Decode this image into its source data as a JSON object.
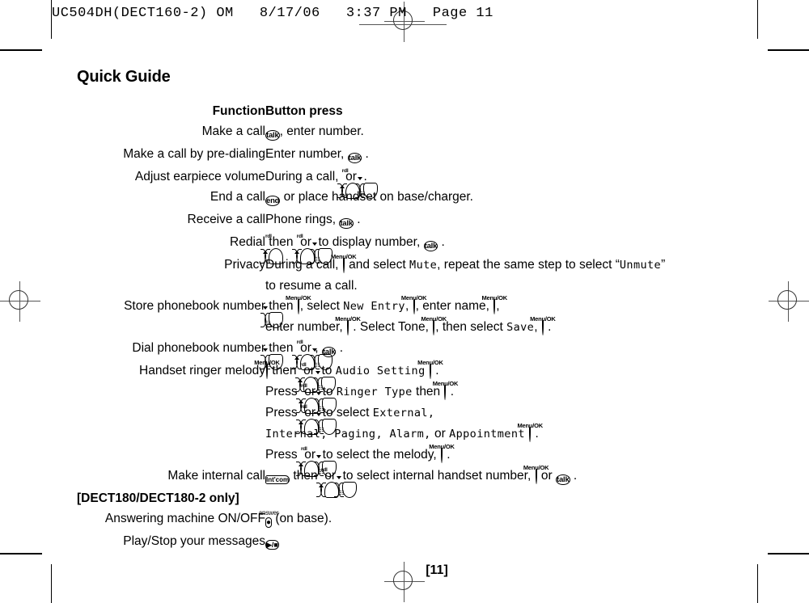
{
  "header_stamp": "UC504DH(DECT160-2) OM   8/17/06   3:37 PM   Page 11",
  "page_title": "Quick Guide",
  "columns": {
    "function": "Function",
    "button_press": "Button press"
  },
  "keys": {
    "talk": "talk",
    "end": "end",
    "intcom": "Int'com",
    "menu_ok": "Menu/OK",
    "nav_up": "rdl",
    "nav_down": "☷",
    "answer_cap": "answer",
    "answer_glyph": "●",
    "play_stop": "▶/■"
  },
  "rows": [
    {
      "function": "Make a call",
      "segments": [
        {
          "t": "key",
          "k": "talk"
        },
        {
          "t": "txt",
          "v": ", enter number."
        }
      ]
    },
    {
      "function": "Make a call by pre-dialing",
      "segments": [
        {
          "t": "txt",
          "v": "Enter number, "
        },
        {
          "t": "key",
          "k": "talk"
        },
        {
          "t": "txt",
          "v": " ."
        }
      ]
    },
    {
      "function": "Adjust earpiece volume",
      "segments": [
        {
          "t": "txt",
          "v": "During a call, "
        },
        {
          "t": "key",
          "k": "nav_up"
        },
        {
          "t": "txt",
          "v": " or "
        },
        {
          "t": "key",
          "k": "nav_down"
        },
        {
          "t": "txt",
          "v": " ."
        }
      ]
    },
    {
      "function": "End a call",
      "segments": [
        {
          "t": "key",
          "k": "end"
        },
        {
          "t": "txt",
          "v": " or place handset on base/charger."
        }
      ]
    },
    {
      "function": "Receive a call",
      "segments": [
        {
          "t": "txt",
          "v": "Phone rings, "
        },
        {
          "t": "key",
          "k": "talk"
        },
        {
          "t": "txt",
          "v": " ."
        }
      ]
    },
    {
      "function": "Redial",
      "segments": [
        {
          "t": "key",
          "k": "nav_up"
        },
        {
          "t": "txt",
          "v": " then "
        },
        {
          "t": "key",
          "k": "nav_up"
        },
        {
          "t": "txt",
          "v": " or "
        },
        {
          "t": "key",
          "k": "nav_down"
        },
        {
          "t": "txt",
          "v": " to display number, "
        },
        {
          "t": "key",
          "k": "talk"
        },
        {
          "t": "txt",
          "v": " ."
        }
      ]
    },
    {
      "function": "Privacy",
      "segments": [
        {
          "t": "txt",
          "v": "During a call, "
        },
        {
          "t": "key",
          "k": "menu_ok"
        },
        {
          "t": "txt",
          "v": " and select "
        },
        {
          "t": "lcd",
          "v": "Mute"
        },
        {
          "t": "txt",
          "v": ", repeat the same step to select “"
        },
        {
          "t": "lcd",
          "v": "Unmute"
        },
        {
          "t": "txt",
          "v": "”"
        },
        {
          "t": "br"
        },
        {
          "t": "txt",
          "v": "to resume a call."
        }
      ]
    },
    {
      "function": "Store phonebook number",
      "segments": [
        {
          "t": "key",
          "k": "nav_down"
        },
        {
          "t": "txt",
          "v": " then "
        },
        {
          "t": "key",
          "k": "menu_ok"
        },
        {
          "t": "txt",
          "v": ", select "
        },
        {
          "t": "lcd",
          "v": "New Entry"
        },
        {
          "t": "txt",
          "v": ", "
        },
        {
          "t": "key",
          "k": "menu_ok"
        },
        {
          "t": "txt",
          "v": ", enter name, "
        },
        {
          "t": "key",
          "k": "menu_ok"
        },
        {
          "t": "txt",
          "v": ", "
        },
        {
          "t": "br"
        },
        {
          "t": "txt",
          "v": "enter number, "
        },
        {
          "t": "key",
          "k": "menu_ok"
        },
        {
          "t": "txt",
          "v": " . Select Tone, "
        },
        {
          "t": "key",
          "k": "menu_ok"
        },
        {
          "t": "txt",
          "v": ", then select "
        },
        {
          "t": "lcd",
          "v": "Save"
        },
        {
          "t": "txt",
          "v": ", "
        },
        {
          "t": "key",
          "k": "menu_ok"
        },
        {
          "t": "txt",
          "v": " ."
        }
      ]
    },
    {
      "function": "Dial phonebook number",
      "segments": [
        {
          "t": "key",
          "k": "nav_down"
        },
        {
          "t": "txt",
          "v": " then "
        },
        {
          "t": "key",
          "k": "nav_up"
        },
        {
          "t": "txt",
          "v": " or "
        },
        {
          "t": "key",
          "k": "nav_down"
        },
        {
          "t": "txt",
          "v": ", "
        },
        {
          "t": "key",
          "k": "talk"
        },
        {
          "t": "txt",
          "v": " ."
        }
      ]
    },
    {
      "function": "Handset ringer melody",
      "segments": [
        {
          "t": "key",
          "k": "menu_ok"
        },
        {
          "t": "txt",
          "v": " then "
        },
        {
          "t": "key",
          "k": "nav_up"
        },
        {
          "t": "txt",
          "v": " or "
        },
        {
          "t": "key",
          "k": "nav_down"
        },
        {
          "t": "txt",
          "v": " to "
        },
        {
          "t": "lcd",
          "v": "Audio Setting"
        },
        {
          "t": "sp"
        },
        {
          "t": "key",
          "k": "menu_ok"
        },
        {
          "t": "txt",
          "v": " ."
        },
        {
          "t": "br"
        },
        {
          "t": "txt",
          "v": "Press "
        },
        {
          "t": "key",
          "k": "nav_up"
        },
        {
          "t": "txt",
          "v": " or "
        },
        {
          "t": "key",
          "k": "nav_down"
        },
        {
          "t": "txt",
          "v": " to "
        },
        {
          "t": "lcd",
          "v": "Ringer Type"
        },
        {
          "t": "txt",
          "v": " then "
        },
        {
          "t": "key",
          "k": "menu_ok"
        },
        {
          "t": "txt",
          "v": " ."
        },
        {
          "t": "br"
        },
        {
          "t": "txt",
          "v": "Press "
        },
        {
          "t": "key",
          "k": "nav_up"
        },
        {
          "t": "txt",
          "v": " or "
        },
        {
          "t": "key",
          "k": "nav_down"
        },
        {
          "t": "txt",
          "v": " to select "
        },
        {
          "t": "lcd",
          "v": "External,"
        },
        {
          "t": "br"
        },
        {
          "t": "lcd",
          "v": "Internal, Paging, Alarm,"
        },
        {
          "t": "txt",
          "v": " or "
        },
        {
          "t": "lcd",
          "v": "Appointment"
        },
        {
          "t": "sp"
        },
        {
          "t": "key",
          "k": "menu_ok"
        },
        {
          "t": "txt",
          "v": " ."
        },
        {
          "t": "br"
        },
        {
          "t": "txt",
          "v": "Press "
        },
        {
          "t": "key",
          "k": "nav_up"
        },
        {
          "t": "txt",
          "v": " or "
        },
        {
          "t": "key",
          "k": "nav_down"
        },
        {
          "t": "txt",
          "v": " to select the melody, "
        },
        {
          "t": "key",
          "k": "menu_ok"
        },
        {
          "t": "txt",
          "v": " ."
        }
      ]
    },
    {
      "function": "Make internal call",
      "segments": [
        {
          "t": "key",
          "k": "intcom"
        },
        {
          "t": "txt",
          "v": " then "
        },
        {
          "t": "key",
          "k": "nav_up"
        },
        {
          "t": "txt",
          "v": " or "
        },
        {
          "t": "key",
          "k": "nav_down"
        },
        {
          "t": "txt",
          "v": " to select internal handset number, "
        },
        {
          "t": "key",
          "k": "menu_ok"
        },
        {
          "t": "txt",
          "v": " or "
        },
        {
          "t": "key",
          "k": "talk"
        },
        {
          "t": "txt",
          "v": " ."
        }
      ]
    }
  ],
  "only_note": "[DECT180/DECT180-2 only]",
  "rows_after_note": [
    {
      "function": "Answering machine ON/OFF",
      "segments": [
        {
          "t": "key",
          "k": "answer"
        },
        {
          "t": "txt",
          "v": " (on base)."
        }
      ]
    },
    {
      "function": "Play/Stop your messages",
      "segments": [
        {
          "t": "key",
          "k": "play_stop"
        }
      ]
    }
  ],
  "page_number": "[11]"
}
